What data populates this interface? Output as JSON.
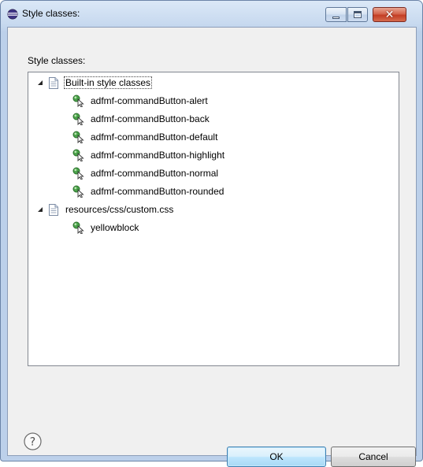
{
  "window": {
    "title": "Style classes:",
    "title_icon": "eclipse-icon",
    "controls": {
      "minimize_icon": "minimize-icon",
      "maximize_icon": "maximize-icon",
      "close_icon": "close-icon",
      "close_glyph": "✕"
    }
  },
  "dialog": {
    "section_label": "Style classes:",
    "tree": [
      {
        "label": "Built-in style classes",
        "icon": "file-icon",
        "expanded": true,
        "children": [
          {
            "label": "adfmf-commandButton-alert",
            "icon": "style-class-icon"
          },
          {
            "label": "adfmf-commandButton-back",
            "icon": "style-class-icon"
          },
          {
            "label": "adfmf-commandButton-default",
            "icon": "style-class-icon"
          },
          {
            "label": "adfmf-commandButton-highlight",
            "icon": "style-class-icon"
          },
          {
            "label": "adfmf-commandButton-normal",
            "icon": "style-class-icon"
          },
          {
            "label": "adfmf-commandButton-rounded",
            "icon": "style-class-icon"
          }
        ]
      },
      {
        "label": "resources/css/custom.css",
        "icon": "file-icon",
        "expanded": true,
        "children": [
          {
            "label": "yellowblock",
            "icon": "style-class-icon"
          }
        ]
      }
    ],
    "help_icon": "help-icon",
    "help_glyph": "?",
    "ok_label": "OK",
    "cancel_label": "Cancel"
  },
  "colors": {
    "titlebar": "#c7d9ef",
    "close_button": "#c33e25",
    "dialog_background": "#f0f0f0",
    "tree_background": "#ffffff",
    "default_button_border": "#3c7fb1"
  }
}
